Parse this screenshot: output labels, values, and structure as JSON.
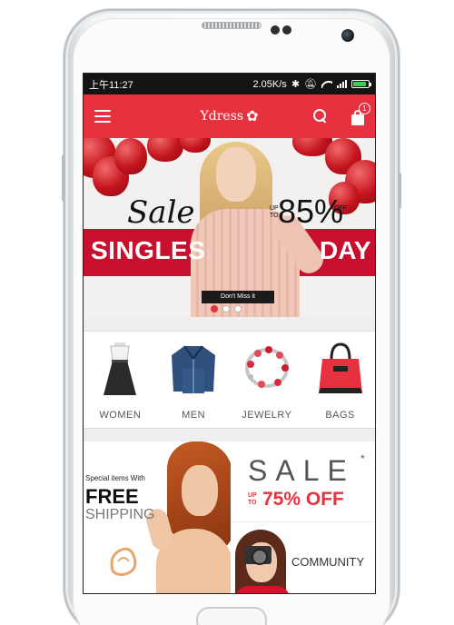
{
  "status_bar": {
    "time": "上午11:27",
    "network_speed": "2.05K/s",
    "icons": [
      "bluetooth-icon",
      "mute-icon",
      "wifi-icon",
      "signal-icon",
      "battery-icon"
    ]
  },
  "app_bar": {
    "brand": "Ydress",
    "brand_icon": "flower-icon",
    "cart_count": "1",
    "accent_color": "#e8313e"
  },
  "banner": {
    "sale_word": "Sale",
    "up_to": "UP TO",
    "discount": "85%",
    "off": "OFF",
    "line_left": "SINGLES",
    "line_right": "DAY",
    "cta": "Don't Miss it",
    "slides": 3,
    "active_slide": 1
  },
  "categories": [
    {
      "label": "WOMEN",
      "icon": "dress-icon"
    },
    {
      "label": "MEN",
      "icon": "jacket-icon"
    },
    {
      "label": "JEWELRY",
      "icon": "bracelet-icon"
    },
    {
      "label": "BAGS",
      "icon": "handbag-icon"
    }
  ],
  "promo": {
    "special": "Special items With",
    "free": "FREE",
    "shipping": "SHIPPING",
    "sale": "SALE",
    "sale_star": "*",
    "up_to": "UP TO",
    "discount": "75% OFF",
    "community": "COMMUNITY"
  }
}
